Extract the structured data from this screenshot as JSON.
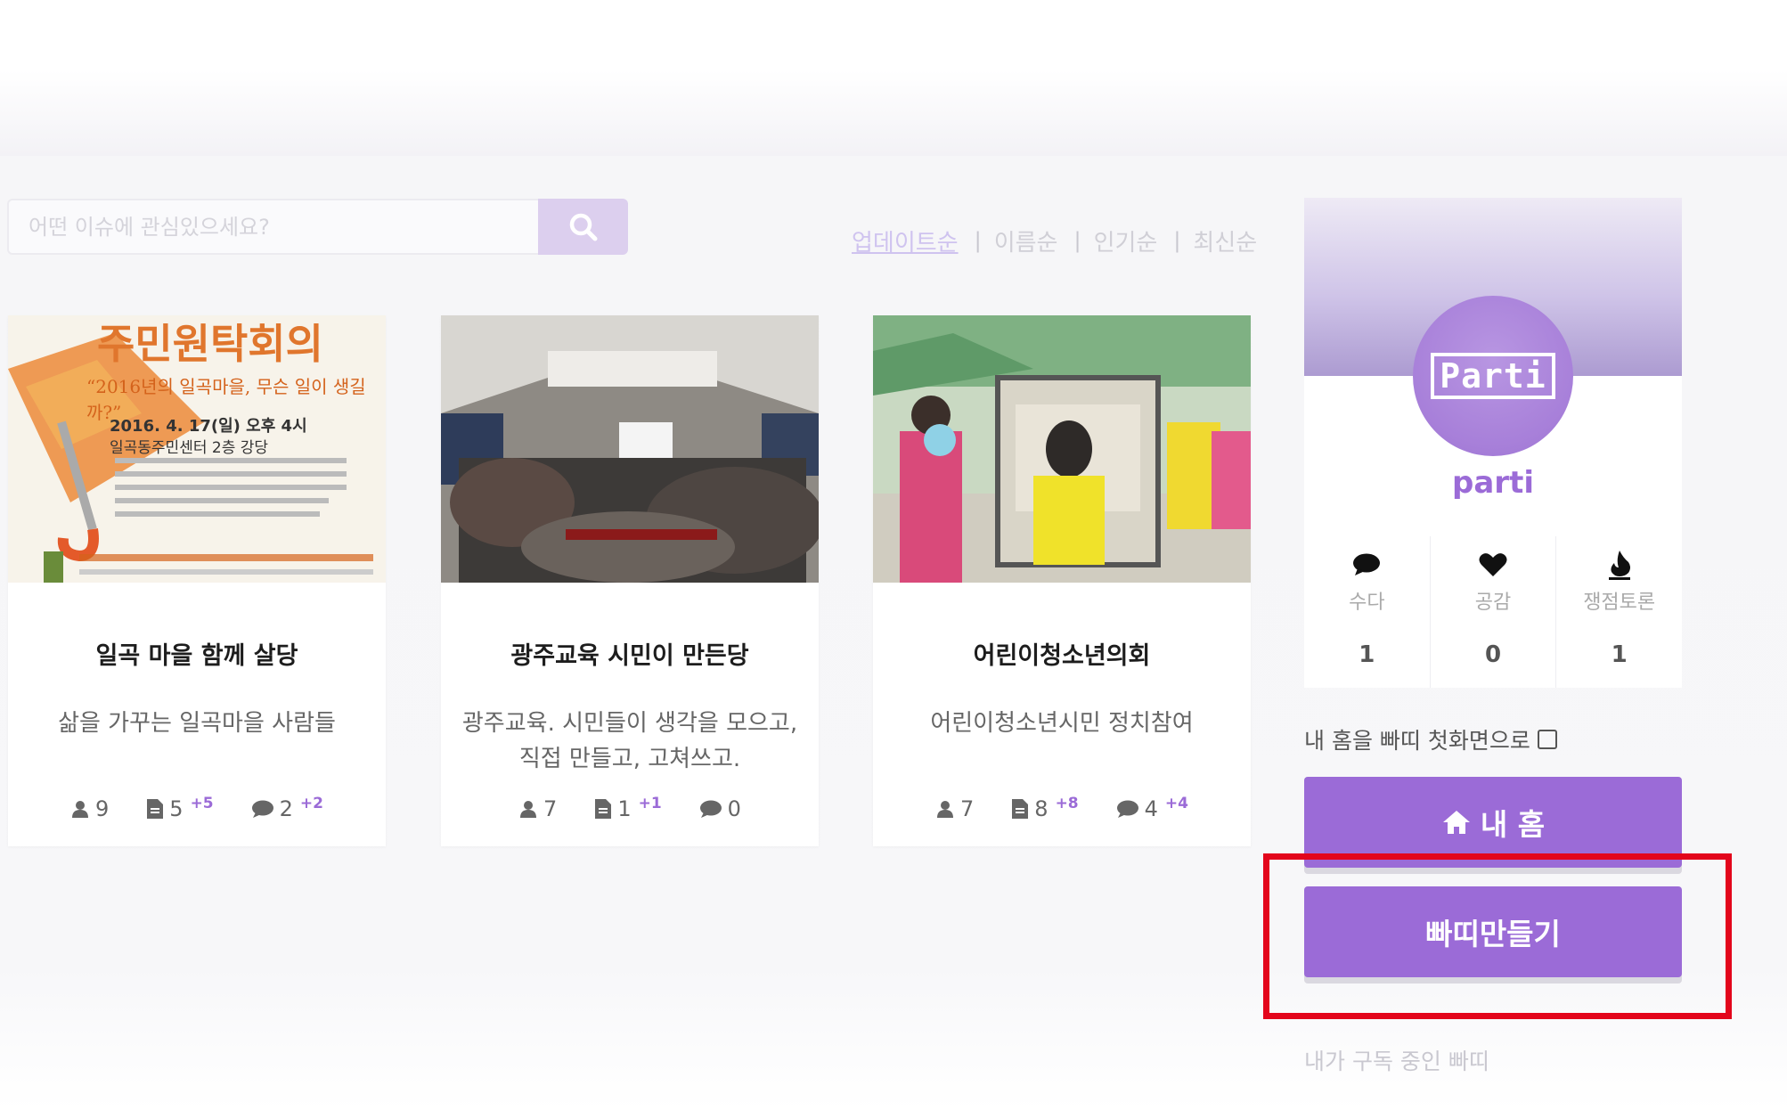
{
  "search": {
    "placeholder": "어떤 이슈에 관심있으세요?"
  },
  "sort": {
    "active": "업데이트순",
    "options": [
      "이름순",
      "인기순",
      "최신순"
    ]
  },
  "cards": [
    {
      "title": "일곡 마을 함께 살당",
      "description": "삶을 가꾸는 일곡마을 사람들",
      "image_text": {
        "heading": "주민원탁회의",
        "quote": "“2016년의 일곡마을, 무슨 일이 생길까?”",
        "date": "2016. 4. 17(일) 오후 4시",
        "venue": "일곡동주민센터 2층 강당"
      },
      "members": "9",
      "posts": "5",
      "posts_new": "+5",
      "comments": "2",
      "comments_new": "+2"
    },
    {
      "title": "광주교육 시민이 만든당",
      "description_line1": "광주교육. 시민들이 생각을 모으고,",
      "description_line2": "직접 만들고, 고쳐쓰고.",
      "members": "7",
      "posts": "1",
      "posts_new": "+1",
      "comments": "0"
    },
    {
      "title": "어린이청소년의회",
      "description": "어린이청소년시민 정치참여",
      "members": "7",
      "posts": "8",
      "posts_new": "+8",
      "comments": "4",
      "comments_new": "+4"
    }
  ],
  "profile": {
    "logo_text": "Parti",
    "name": "parti",
    "stats": [
      {
        "label": "수다",
        "value": "1",
        "icon": "speech-bubble-icon"
      },
      {
        "label": "공감",
        "value": "0",
        "icon": "heart-icon"
      },
      {
        "label": "쟁점토론",
        "value": "1",
        "icon": "flame-icon"
      }
    ]
  },
  "home_toggle": {
    "label": "내 홈을 빠띠 첫화면으로"
  },
  "buttons": {
    "my_home": "내 홈",
    "create_parti": "빠띠만들기"
  },
  "subscribed_label": "내가 구독 중인 빠띠",
  "colors": {
    "accent": "#9b6bd7",
    "highlight": "#e3061c"
  }
}
